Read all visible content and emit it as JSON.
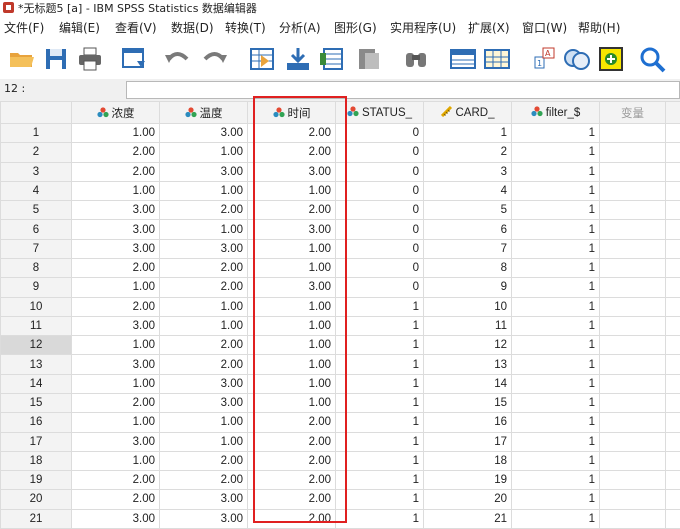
{
  "window": {
    "title": "*无标题5 [a] - IBM SPSS Statistics 数据编辑器"
  },
  "menu": [
    "文件(F)",
    "编辑(E)",
    "查看(V)",
    "数据(D)",
    "转换(T)",
    "分析(A)",
    "图形(G)",
    "实用程序(U)",
    "扩展(X)",
    "窗口(W)",
    "帮助(H)"
  ],
  "toolbar": {
    "icons": [
      "open-folder-icon",
      "save-icon",
      "print-icon",
      "dialog-recall-icon",
      "undo-icon",
      "redo-icon",
      "goto-case-icon",
      "goto-variable-icon",
      "variables-icon",
      "run-descriptives-icon",
      "find-icon",
      "insert-cases-icon",
      "insert-variable-icon",
      "split-file-icon",
      "weight-cases-icon",
      "select-cases-icon",
      "value-labels-icon",
      "search-icon"
    ]
  },
  "reference_bar": {
    "cell_ref": "12 :",
    "cell_value": ""
  },
  "columns": [
    {
      "name": "浓度",
      "type": "nominal"
    },
    {
      "name": "温度",
      "type": "nominal"
    },
    {
      "name": "时间",
      "type": "nominal"
    },
    {
      "name": "STATUS_",
      "type": "nominal"
    },
    {
      "name": "CARD_",
      "type": "scale"
    },
    {
      "name": "filter_$",
      "type": "nominal"
    },
    {
      "name": "变量",
      "type": "empty"
    }
  ],
  "rows": [
    {
      "n": "1",
      "v": [
        "1.00",
        "3.00",
        "2.00",
        "0",
        "1",
        "1"
      ]
    },
    {
      "n": "2",
      "v": [
        "2.00",
        "1.00",
        "2.00",
        "0",
        "2",
        "1"
      ]
    },
    {
      "n": "3",
      "v": [
        "2.00",
        "3.00",
        "3.00",
        "0",
        "3",
        "1"
      ]
    },
    {
      "n": "4",
      "v": [
        "1.00",
        "1.00",
        "1.00",
        "0",
        "4",
        "1"
      ]
    },
    {
      "n": "5",
      "v": [
        "3.00",
        "2.00",
        "2.00",
        "0",
        "5",
        "1"
      ]
    },
    {
      "n": "6",
      "v": [
        "3.00",
        "1.00",
        "3.00",
        "0",
        "6",
        "1"
      ]
    },
    {
      "n": "7",
      "v": [
        "3.00",
        "3.00",
        "1.00",
        "0",
        "7",
        "1"
      ]
    },
    {
      "n": "8",
      "v": [
        "2.00",
        "2.00",
        "1.00",
        "0",
        "8",
        "1"
      ]
    },
    {
      "n": "9",
      "v": [
        "1.00",
        "2.00",
        "3.00",
        "0",
        "9",
        "1"
      ]
    },
    {
      "n": "10",
      "v": [
        "2.00",
        "1.00",
        "1.00",
        "1",
        "10",
        "1"
      ]
    },
    {
      "n": "11",
      "v": [
        "3.00",
        "1.00",
        "1.00",
        "1",
        "11",
        "1"
      ]
    },
    {
      "n": "12",
      "v": [
        "1.00",
        "2.00",
        "1.00",
        "1",
        "12",
        "1"
      ]
    },
    {
      "n": "13",
      "v": [
        "3.00",
        "2.00",
        "1.00",
        "1",
        "13",
        "1"
      ]
    },
    {
      "n": "14",
      "v": [
        "1.00",
        "3.00",
        "1.00",
        "1",
        "14",
        "1"
      ]
    },
    {
      "n": "15",
      "v": [
        "2.00",
        "3.00",
        "1.00",
        "1",
        "15",
        "1"
      ]
    },
    {
      "n": "16",
      "v": [
        "1.00",
        "1.00",
        "2.00",
        "1",
        "16",
        "1"
      ]
    },
    {
      "n": "17",
      "v": [
        "3.00",
        "1.00",
        "2.00",
        "1",
        "17",
        "1"
      ]
    },
    {
      "n": "18",
      "v": [
        "1.00",
        "2.00",
        "2.00",
        "1",
        "18",
        "1"
      ]
    },
    {
      "n": "19",
      "v": [
        "2.00",
        "2.00",
        "2.00",
        "1",
        "19",
        "1"
      ]
    },
    {
      "n": "20",
      "v": [
        "2.00",
        "3.00",
        "2.00",
        "1",
        "20",
        "1"
      ]
    },
    {
      "n": "21",
      "v": [
        "3.00",
        "3.00",
        "2.00",
        "1",
        "21",
        "1"
      ]
    }
  ],
  "selected_row": "12",
  "highlighted_column": "时间",
  "colors": {
    "highlight": "#e02020",
    "selected_rowhead": "#d9d9d9",
    "header_bg": "#f3f3f3"
  }
}
